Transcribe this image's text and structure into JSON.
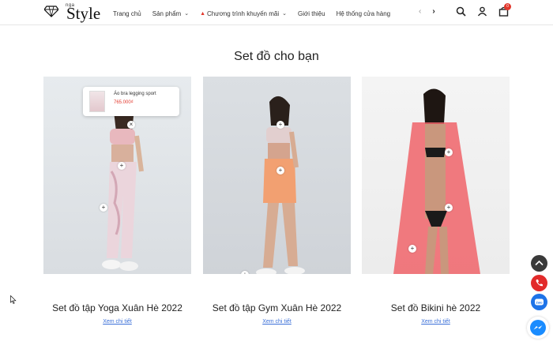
{
  "header": {
    "logo": {
      "small_text": "nga",
      "word": "Style"
    },
    "nav": [
      {
        "label": "Trang chủ",
        "has_chevron": false
      },
      {
        "label": "Sản phẩm",
        "has_chevron": true
      },
      {
        "label": "Chương trình khuyến mãi",
        "has_chevron": true,
        "icon": "fire-icon"
      },
      {
        "label": "Giới thiệu",
        "has_chevron": false
      },
      {
        "label": "Hệ thống cửa hàng",
        "has_chevron": false
      }
    ],
    "cart_count": "0",
    "icons": [
      "search-icon",
      "user-icon",
      "shopping-bag-icon"
    ]
  },
  "section": {
    "title": "Set đồ cho bạn"
  },
  "cards": [
    {
      "name": "Set đồ tập Yoga Xuân Hè 2022",
      "link": "Xem chi tiết",
      "popup": {
        "product": "Áo bra legging sport",
        "price": "765.000₫"
      }
    },
    {
      "name": "Set đồ tập Gym Xuân Hè 2022",
      "link": "Xem chi tiết"
    },
    {
      "name": "Set đồ Bikini hè 2022",
      "link": "Xem chi tiết"
    }
  ],
  "colors": {
    "accent_red": "#e2372c",
    "link_blue": "#3a6fd8",
    "scroll_top": "#3a3a3a",
    "phone": "#e22b2b",
    "zalo": "#1e73e8",
    "messenger": "#1a8cff"
  },
  "floating_icons": [
    "scroll-top-icon",
    "phone-icon",
    "zalo-icon",
    "messenger-icon"
  ]
}
